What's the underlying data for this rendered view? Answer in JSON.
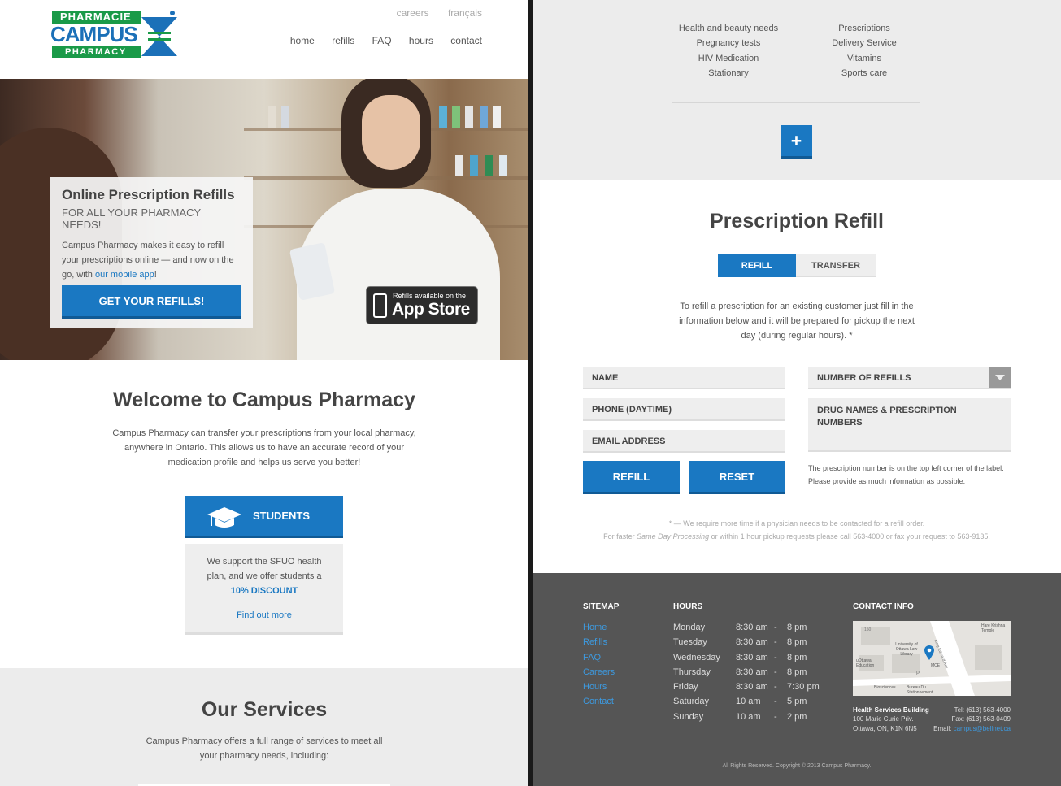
{
  "brand": {
    "name_top": "PHARMACIE",
    "name_main": "CAMPUS",
    "name_bottom": "PHARMACY",
    "colors": {
      "green": "#1a9a48",
      "blue": "#1b70b8",
      "accent": "#1a78c2",
      "footer": "#555555"
    }
  },
  "header": {
    "top_links": [
      "careers",
      "français"
    ],
    "nav": [
      "home",
      "refills",
      "FAQ",
      "hours",
      "contact"
    ]
  },
  "hero": {
    "title": "Online Prescription Refills",
    "subtitle": "FOR ALL YOUR PHARMACY NEEDS!",
    "text_before": "Campus Pharmacy makes it easy to refill your prescriptions online — and now on the go, with ",
    "link": "our mobile app",
    "text_after": "!",
    "cta": "GET YOUR REFILLS!",
    "app_small": "Refills available on the",
    "app_big": "App Store"
  },
  "welcome": {
    "title": "Welcome to Campus Pharmacy",
    "text": "Campus Pharmacy can transfer your prescriptions from your local pharmacy, anywhere in Ontario. This allows us to have an accurate record of your medication profile and helps us serve you better!",
    "students_label": "STUDENTS",
    "students_text": "We support the SFUO health plan, and we offer students a",
    "discount": "10% DISCOUNT",
    "find_more": "Find out more"
  },
  "services": {
    "title": "Our Services",
    "text": "Campus Pharmacy offers a full range of services to meet all your pharmacy needs, including:",
    "col1": [
      "Health and beauty needs",
      "Pregnancy tests",
      "HIV Medication",
      "Stationary"
    ],
    "col2": [
      "Prescriptions",
      "Delivery Service",
      "Vitamins",
      "Sports care"
    ],
    "more_symbol": "+"
  },
  "refill": {
    "title": "Prescription Refill",
    "tabs": [
      "REFILL",
      "TRANSFER"
    ],
    "intro": "To refill a prescription for an existing customer just fill in the information below and it will be prepared for pickup the next day (during regular hours). *",
    "name": "NAME",
    "phone": "PHONE (DAYTIME)",
    "email": "EMAIL ADDRESS",
    "num_refills": "NUMBER OF REFILLS",
    "drug_names": "DRUG NAMES & PRESCRIPTION NUMBERS",
    "refill_btn": "REFILL",
    "reset_btn": "RESET",
    "hint": "The prescription number is on the top left corner of the label. Please provide as much information as possible.",
    "note1": "* — We require more time if a physician needs to be contacted for a refill order.",
    "note2_a": "For faster ",
    "note2_em": "Same Day Processing",
    "note2_b": " or within 1 hour pickup requests please call 563-4000 or fax your request to 563-9135."
  },
  "footer": {
    "sitemap_title": "SITEMAP",
    "sitemap": [
      "Home",
      "Refills",
      "FAQ",
      "Careers",
      "Hours",
      "Contact"
    ],
    "hours_title": "HOURS",
    "hours": [
      {
        "day": "Monday",
        "open": "8:30 am",
        "dash": "-",
        "close": "8 pm"
      },
      {
        "day": "Tuesday",
        "open": "8:30 am",
        "dash": "-",
        "close": "8 pm"
      },
      {
        "day": "Wednesday",
        "open": "8:30 am",
        "dash": "-",
        "close": "8 pm"
      },
      {
        "day": "Thursday",
        "open": "8:30 am",
        "dash": "-",
        "close": "8 pm"
      },
      {
        "day": "Friday",
        "open": "8:30 am",
        "dash": "-",
        "close": "7:30 pm"
      },
      {
        "day": "Saturday",
        "open": "10 am",
        "dash": "-",
        "close": "5 pm"
      },
      {
        "day": "Sunday",
        "open": "10 am",
        "dash": "-",
        "close": "2 pm"
      }
    ],
    "contact_title": "CONTACT INFO",
    "map_labels": [
      "Hare Krishna Temple",
      "University of Ottawa Law Library",
      "uOttawa Education",
      "MCE",
      "Biosciences",
      "Bureau Du Stationnement",
      "King Edward Ave",
      "150",
      "P"
    ],
    "building": "Health Services Building",
    "street": "100 Marie Curie Priv.",
    "city": "Ottawa, ON, K1N 6N5",
    "tel": "Tel: (613) 563-4000",
    "fax": "Fax: (613) 563-0409",
    "email_label": "Email: ",
    "email": "campus@bellnet.ca",
    "copyright": "All Rights Reserved. Copyright © 2013 Campus Pharmacy."
  }
}
